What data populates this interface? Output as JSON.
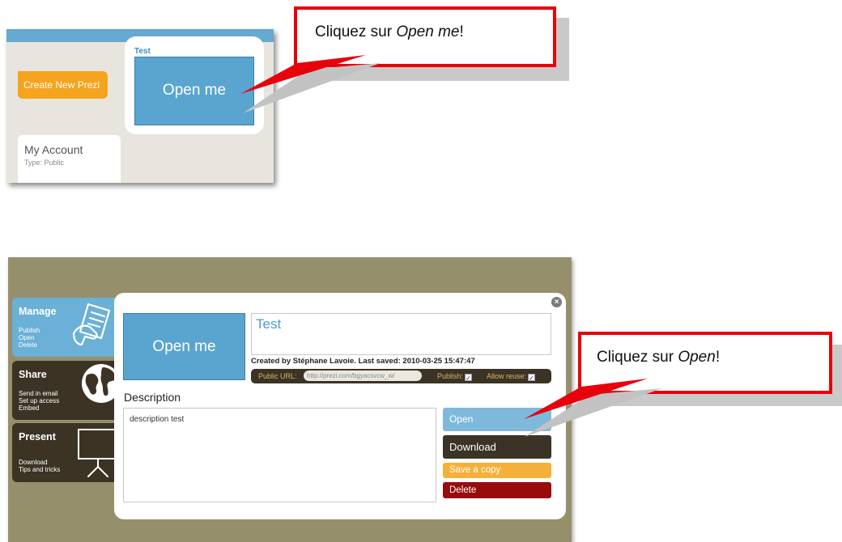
{
  "top_screenshot": {
    "create_button": "Create New Prezi",
    "prezi_title": "Test",
    "prezi_thumbnail": "Open me",
    "account_title": "My Account",
    "account_type": "Type: Public"
  },
  "callout_top": {
    "prefix": "Cliquez sur ",
    "emphasis": "Open me",
    "suffix": "!"
  },
  "bottom_screenshot": {
    "sidebar": [
      {
        "title": "Manage",
        "items": [
          "Publish",
          "Open",
          "Delete"
        ],
        "icon": "hand-document-icon"
      },
      {
        "title": "Share",
        "items": [
          "Send in email",
          "Set up access",
          "Embed"
        ],
        "icon": "globe-icon"
      },
      {
        "title": "Present",
        "items": [
          "Download",
          "Tips and tricks"
        ],
        "icon": "projector-screen-icon"
      }
    ],
    "dialog": {
      "thumbnail_label": "Open me",
      "title": "Test",
      "created_by": "Created by Stéphane Lavoie. Last saved: 2010-03-25 15:47:47",
      "public_url_label": "Public URL:",
      "public_url": "http://prezi.com/bgyacsvcw_w/",
      "publish_label": "Publish:",
      "publish_checked": true,
      "allow_reuse_label": "Allow reuse:",
      "allow_reuse_checked": true,
      "description_label": "Description",
      "description_text": "description test",
      "buttons": {
        "open": "Open",
        "download": "Download",
        "save_copy": "Save a copy",
        "delete": "Delete"
      }
    }
  },
  "callout_bottom": {
    "prefix": "Cliquez sur ",
    "emphasis": "Open",
    "suffix": "!"
  },
  "colors": {
    "callout_border": "#e8000a",
    "prezi_blue": "#5aa5cf",
    "create_orange": "#f4a41d",
    "olive_bg": "#968f6c",
    "dark_brown": "#3b3325",
    "delete_red": "#9a0b0b"
  }
}
